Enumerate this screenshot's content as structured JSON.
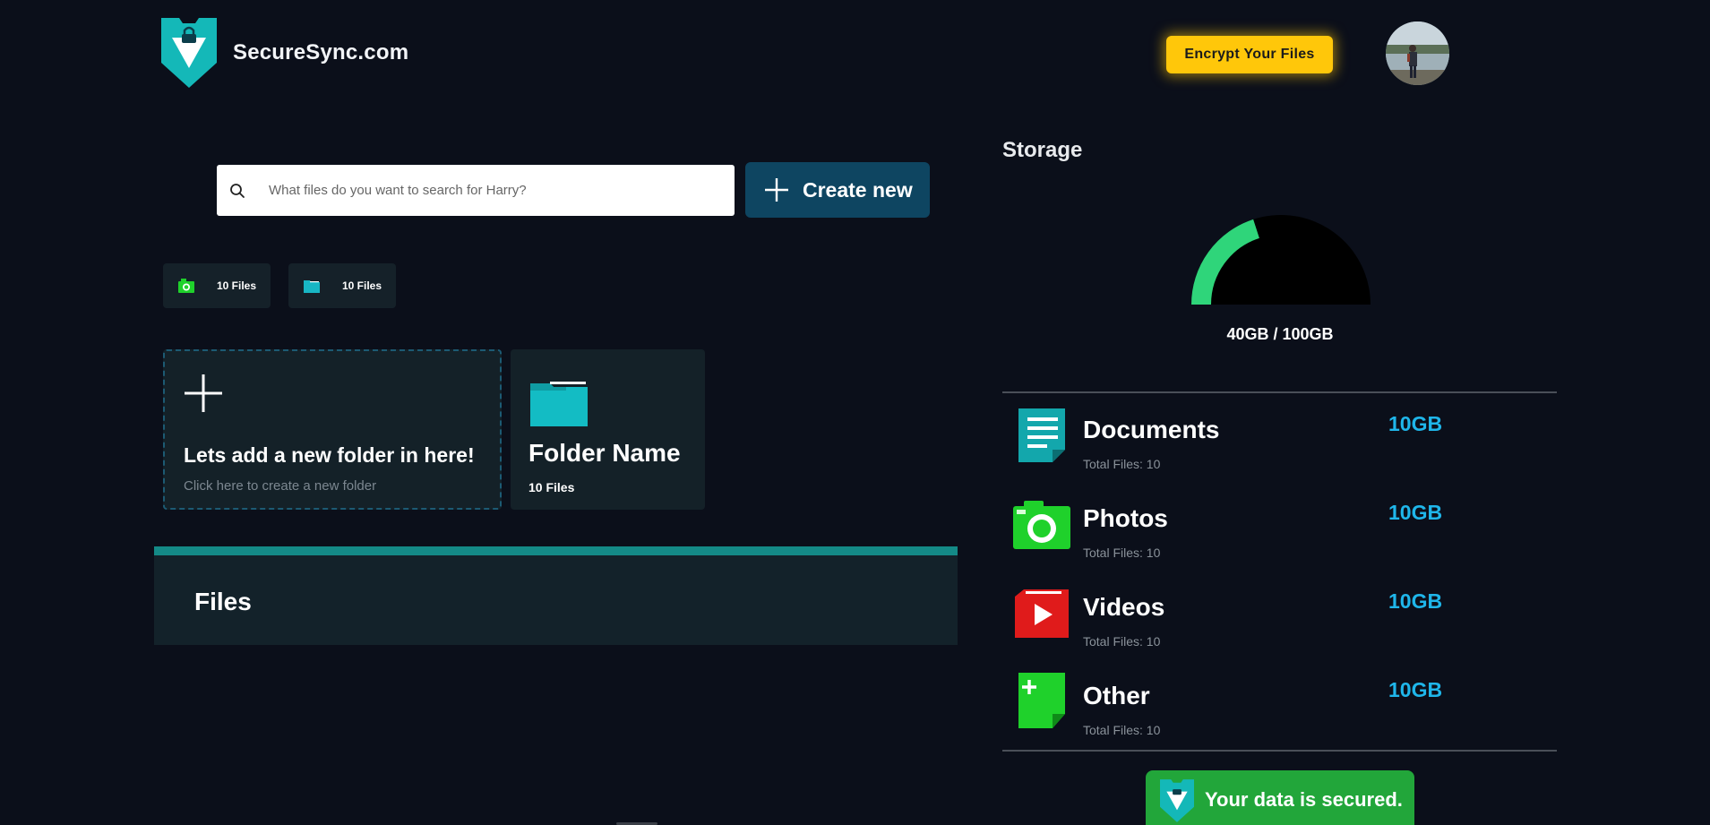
{
  "header": {
    "site_name": "SecureSync.com",
    "logo_icon": "shield-lock-icon",
    "encrypt_button": "Encrypt Your Files",
    "avatar_icon": "user-avatar"
  },
  "search": {
    "placeholder": "What files do you want to search for Harry?",
    "value": "",
    "icon": "search-icon"
  },
  "create_button": {
    "label": "Create new",
    "icon": "plus-icon"
  },
  "quick_chips": [
    {
      "icon": "camera-icon",
      "label": "10 Files",
      "color": "#1fd12b"
    },
    {
      "icon": "folder-icon",
      "label": "10 Files",
      "color": "#18b6c4"
    }
  ],
  "new_folder_card": {
    "title": "Lets add a new folder in here!",
    "subtitle": "Click here to create a new folder"
  },
  "folder_card": {
    "name": "Folder Name",
    "count": "10 Files"
  },
  "files_panel": {
    "title": "Files"
  },
  "storage": {
    "title": "Storage",
    "used_label": "40GB / 100GB",
    "used_fraction": 0.4,
    "gauge_color": "#2fd57a",
    "categories": [
      {
        "name": "Documents",
        "total_files": "Total Files: 10",
        "size": "10GB",
        "icon": "document-icon",
        "color": "#13a7ac"
      },
      {
        "name": "Photos",
        "total_files": "Total Files: 10",
        "size": "10GB",
        "icon": "camera-icon",
        "color": "#1fd12b"
      },
      {
        "name": "Videos",
        "total_files": "Total Files: 10",
        "size": "10GB",
        "icon": "video-icon",
        "color": "#e01b1b"
      },
      {
        "name": "Other",
        "total_files": "Total Files: 10",
        "size": "10GB",
        "icon": "other-file-icon",
        "color": "#1fd12b"
      }
    ]
  },
  "security_banner": {
    "text": "Your data is secured."
  },
  "colors": {
    "accent_yellow": "#ffc70a",
    "accent_teal": "#148a87",
    "size_blue": "#1fb6ea",
    "background": "#0b0f1a"
  }
}
